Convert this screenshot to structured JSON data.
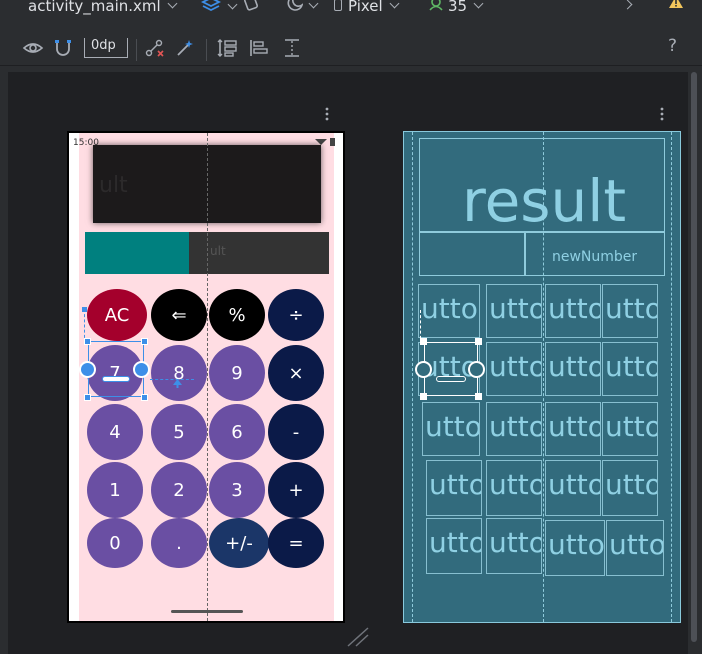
{
  "toolbar": {
    "file_name": "activity_main.xml",
    "device": "Pixel",
    "api_level": "35",
    "margin_value": "0dp",
    "help": "?"
  },
  "design": {
    "status_time": "15:00",
    "result_placeholder": "ult",
    "number_placeholder": "ult",
    "buttons": [
      {
        "label": "AC",
        "color": "#a4002c"
      },
      {
        "label": "⇐",
        "color": "#000000"
      },
      {
        "label": "%",
        "color": "#000000"
      },
      {
        "label": "÷",
        "color": "#0b1a48"
      },
      {
        "label": "7",
        "color": "#6a4fa3"
      },
      {
        "label": "8",
        "color": "#6a4fa3"
      },
      {
        "label": "9",
        "color": "#6a4fa3"
      },
      {
        "label": "×",
        "color": "#0b1a48"
      },
      {
        "label": "4",
        "color": "#6a4fa3"
      },
      {
        "label": "5",
        "color": "#6a4fa3"
      },
      {
        "label": "6",
        "color": "#6a4fa3"
      },
      {
        "label": "-",
        "color": "#0b1a48"
      },
      {
        "label": "1",
        "color": "#6a4fa3"
      },
      {
        "label": "2",
        "color": "#6a4fa3"
      },
      {
        "label": "3",
        "color": "#6a4fa3"
      },
      {
        "label": "+",
        "color": "#0b1a48"
      },
      {
        "label": "0",
        "color": "#6a4fa3"
      },
      {
        "label": ".",
        "color": "#6a4fa3"
      },
      {
        "label": "+/-",
        "color": "#1b3668"
      },
      {
        "label": "=",
        "color": "#0b1a48"
      }
    ]
  },
  "blueprint": {
    "result_label": "result",
    "number_label": "newNumber",
    "cell_label": "utto"
  },
  "colors": {
    "accent_selection": "#3d8fe8",
    "phone_background": "#ffdde3",
    "blueprint_background": "#326b7d"
  }
}
